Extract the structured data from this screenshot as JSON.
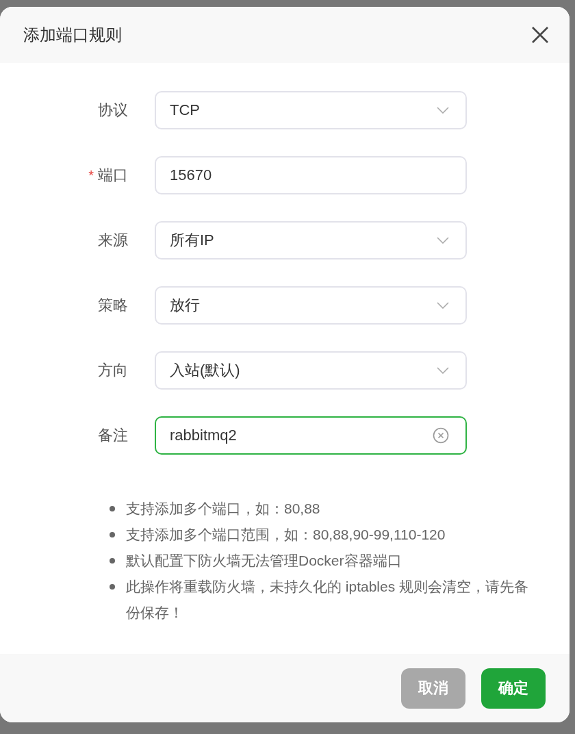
{
  "dialog": {
    "title": "添加端口规则"
  },
  "fields": [
    {
      "kind": "select",
      "label": "协议",
      "value": "TCP",
      "focused": false
    },
    {
      "kind": "input",
      "required_mark": "*",
      "label": "端口",
      "value": "15670",
      "focused": false
    },
    {
      "kind": "select",
      "label": "来源",
      "value": "所有IP",
      "focused": false
    },
    {
      "kind": "select",
      "label": "策略",
      "value": "放行",
      "focused": false
    },
    {
      "kind": "select",
      "label": "方向",
      "value": "入站(默认)",
      "focused": false
    },
    {
      "kind": "clearable",
      "label": "备注",
      "value": "rabbitmq2",
      "focused": true
    }
  ],
  "hints": [
    "支持添加多个端口，如：80,88",
    "支持添加多个端口范围，如：80,88,90-99,110-120",
    "默认配置下防火墙无法管理Docker容器端口",
    "此操作将重载防火墙，未持久化的 iptables 规则会清空，请先备份保存！"
  ],
  "buttons": [
    {
      "kind": "secondary",
      "label": "取消"
    },
    {
      "kind": "primary",
      "label": "确定"
    }
  ]
}
